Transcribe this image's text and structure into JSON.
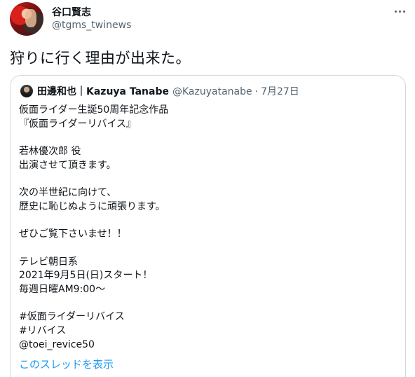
{
  "author": {
    "name": "谷口賢志",
    "handle": "@tgms_twinews"
  },
  "tweet": {
    "text": "狩りに行く理由が出来た。"
  },
  "quoted": {
    "name": "田邊和也｜Kazuya Tanabe",
    "handle": "@Kazuyatanabe",
    "separator": "·",
    "date": "7月27日",
    "lines": [
      "仮面ライダー生誕50周年記念作品",
      "『仮面ライダーリバイス』",
      "",
      "若林優次郎 役",
      "出演させて頂きます。",
      "",
      "次の半世紀に向けて、",
      "歴史に恥じぬように頑張ります。",
      "",
      "ぜひご覧下さいませ！！",
      "",
      "テレビ朝日系",
      "2021年9月5日(日)スタート！",
      "毎週日曜AM9:00～",
      "",
      "#仮面ライダーリバイス",
      "#リバイス",
      "@toei_revice50"
    ],
    "show_thread_label": "このスレッドを表示"
  },
  "icons": {
    "more": "more-horizontal-icon"
  },
  "colors": {
    "text": "#0f1419",
    "secondary": "#536471",
    "link": "#1d9bf0",
    "border": "#cfd9de"
  }
}
